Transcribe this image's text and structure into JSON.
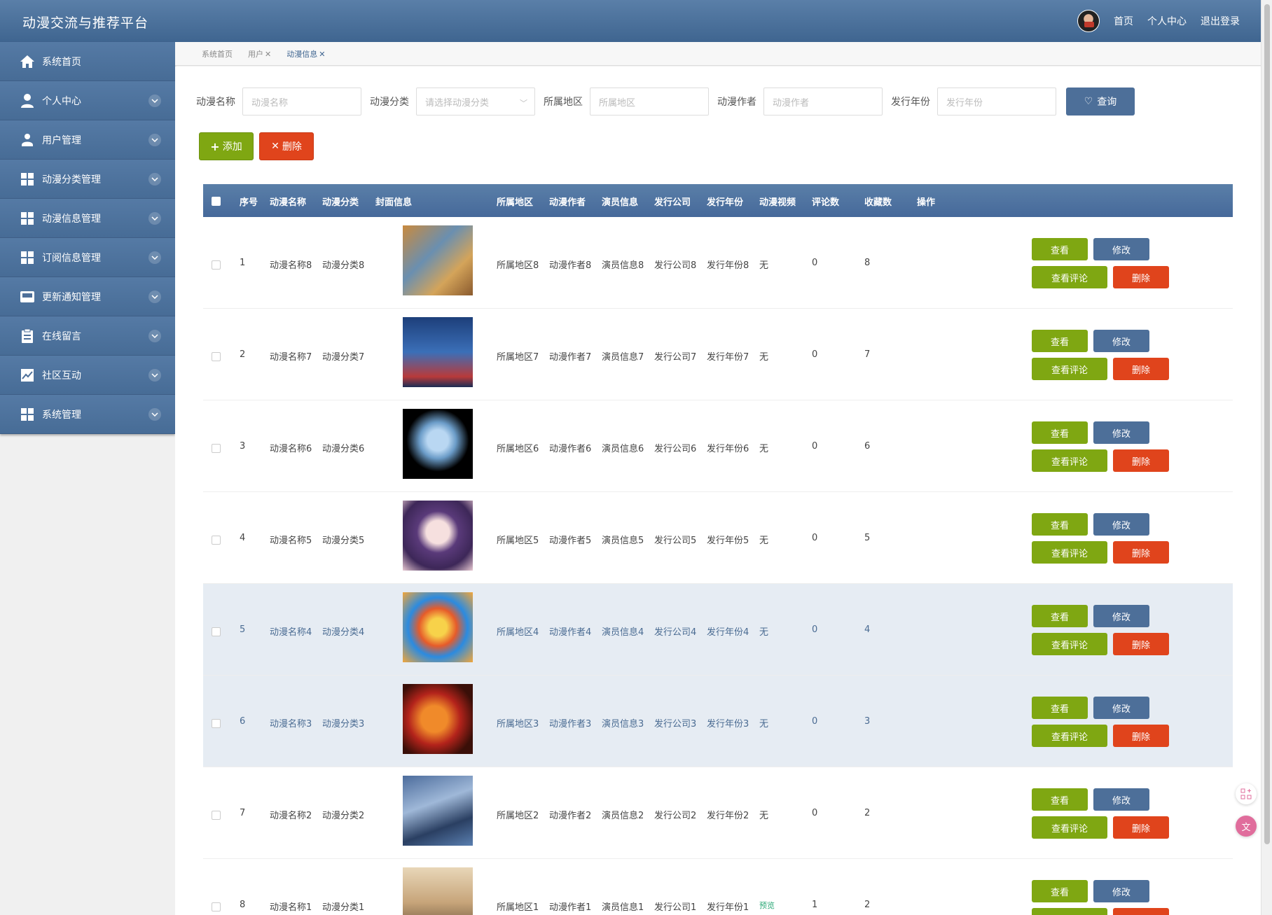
{
  "header": {
    "title": "动漫交流与推荐平台",
    "links": [
      "首页",
      "个人中心",
      "退出登录"
    ]
  },
  "sidebar": {
    "items": [
      {
        "label": "系统首页",
        "icon": "home-icon"
      },
      {
        "label": "个人中心",
        "icon": "user-icon"
      },
      {
        "label": "用户管理",
        "icon": "user-manage-icon"
      },
      {
        "label": "动漫分类管理",
        "icon": "grid-icon"
      },
      {
        "label": "动漫信息管理",
        "icon": "grid-icon"
      },
      {
        "label": "订阅信息管理",
        "icon": "grid-icon"
      },
      {
        "label": "更新通知管理",
        "icon": "inbox-icon"
      },
      {
        "label": "在线留言",
        "icon": "clipboard-icon"
      },
      {
        "label": "社区互动",
        "icon": "chart-icon"
      },
      {
        "label": "系统管理",
        "icon": "grid-icon"
      }
    ]
  },
  "tabs": {
    "home": "系统首页",
    "user": "用户",
    "anime": "动漫信息",
    "close": "✕"
  },
  "search": {
    "name_label": "动漫名称",
    "name_placeholder": "动漫名称",
    "category_label": "动漫分类",
    "category_placeholder": "请选择动漫分类",
    "region_label": "所属地区",
    "region_placeholder": "所属地区",
    "author_label": "动漫作者",
    "author_placeholder": "动漫作者",
    "year_label": "发行年份",
    "year_placeholder": "发行年份",
    "query_label": "查询"
  },
  "toolbar": {
    "add_label": "添加",
    "delete_label": "删除"
  },
  "table": {
    "headers": {
      "index": "序号",
      "name": "动漫名称",
      "category": "动漫分类",
      "cover": "封面信息",
      "region": "所属地区",
      "author": "动漫作者",
      "actors": "演员信息",
      "company": "发行公司",
      "year": "发行年份",
      "video": "动漫视频",
      "comments": "评论数",
      "favorites": "收藏数",
      "ops": "操作"
    },
    "op_labels": {
      "view": "查看",
      "edit": "修改",
      "comment": "查看评论",
      "remove": "删除"
    },
    "rows": [
      {
        "index": "1",
        "name": "动漫名称8",
        "category": "动漫分类8",
        "region": "所属地区8",
        "author": "动漫作者8",
        "actors": "演员信息8",
        "company": "发行公司8",
        "year": "发行年份8",
        "video": "无",
        "comments": "0",
        "favorites": "8"
      },
      {
        "index": "2",
        "name": "动漫名称7",
        "category": "动漫分类7",
        "region": "所属地区7",
        "author": "动漫作者7",
        "actors": "演员信息7",
        "company": "发行公司7",
        "year": "发行年份7",
        "video": "无",
        "comments": "0",
        "favorites": "7"
      },
      {
        "index": "3",
        "name": "动漫名称6",
        "category": "动漫分类6",
        "region": "所属地区6",
        "author": "动漫作者6",
        "actors": "演员信息6",
        "company": "发行公司6",
        "year": "发行年份6",
        "video": "无",
        "comments": "0",
        "favorites": "6"
      },
      {
        "index": "4",
        "name": "动漫名称5",
        "category": "动漫分类5",
        "region": "所属地区5",
        "author": "动漫作者5",
        "actors": "演员信息5",
        "company": "发行公司5",
        "year": "发行年份5",
        "video": "无",
        "comments": "0",
        "favorites": "5"
      },
      {
        "index": "5",
        "name": "动漫名称4",
        "category": "动漫分类4",
        "region": "所属地区4",
        "author": "动漫作者4",
        "actors": "演员信息4",
        "company": "发行公司4",
        "year": "发行年份4",
        "video": "无",
        "comments": "0",
        "favorites": "4"
      },
      {
        "index": "6",
        "name": "动漫名称3",
        "category": "动漫分类3",
        "region": "所属地区3",
        "author": "动漫作者3",
        "actors": "演员信息3",
        "company": "发行公司3",
        "year": "发行年份3",
        "video": "无",
        "comments": "0",
        "favorites": "3"
      },
      {
        "index": "7",
        "name": "动漫名称2",
        "category": "动漫分类2",
        "region": "所属地区2",
        "author": "动漫作者2",
        "actors": "演员信息2",
        "company": "发行公司2",
        "year": "发行年份2",
        "video": "无",
        "comments": "0",
        "favorites": "2"
      },
      {
        "index": "8",
        "name": "动漫名称1",
        "category": "动漫分类1",
        "region": "所属地区1",
        "author": "动漫作者1",
        "actors": "演员信息1",
        "company": "发行公司1",
        "year": "发行年份1",
        "video": "预览",
        "comments": "1",
        "favorites": "2"
      }
    ]
  },
  "colors": {
    "primary": "#4d6f99",
    "success": "#7fa712",
    "danger": "#e0441c",
    "highlight_row": "#e6ecf3"
  }
}
